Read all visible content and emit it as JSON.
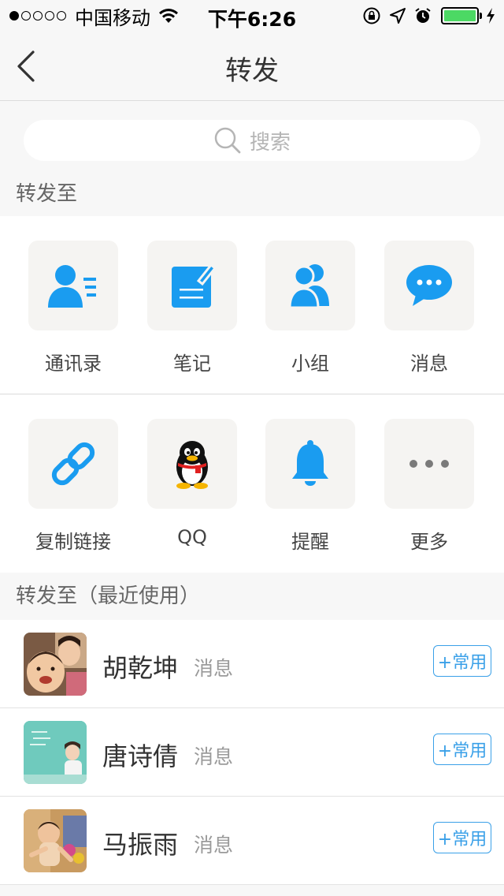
{
  "status_bar": {
    "signal_dots_filled": 1,
    "signal_dots_total": 5,
    "carrier": "中国移动",
    "time": "下午6:26",
    "battery_level": 1.0,
    "battery_color": "#4cd964",
    "icons": [
      "wifi-icon",
      "rotation-lock-icon",
      "location-arrow-icon",
      "alarm-icon",
      "charging-bolt-icon"
    ]
  },
  "nav": {
    "title": "转发",
    "back_icon": "chevron-left-icon"
  },
  "search": {
    "placeholder": "搜索"
  },
  "share_section": {
    "label": "转发至",
    "items": [
      {
        "label": "通讯录",
        "icon": "contacts-icon"
      },
      {
        "label": "笔记",
        "icon": "note-edit-icon"
      },
      {
        "label": "小组",
        "icon": "group-icon"
      },
      {
        "label": "消息",
        "icon": "chat-bubble-icon"
      },
      {
        "label": "复制链接",
        "icon": "link-icon"
      },
      {
        "label": "QQ",
        "icon": "qq-penguin-icon"
      },
      {
        "label": "提醒",
        "icon": "bell-icon"
      },
      {
        "label": "更多",
        "icon": "more-dots-icon"
      }
    ]
  },
  "recent_section": {
    "label": "转发至（最近使用）",
    "contacts": [
      {
        "name": "胡乾坤",
        "type": "消息",
        "action": "+常用"
      },
      {
        "name": "唐诗倩",
        "type": "消息",
        "action": "+常用"
      },
      {
        "name": "马振雨",
        "type": "消息",
        "action": "+常用"
      }
    ]
  },
  "colors": {
    "accent": "#1a9cf0",
    "background": "#f7f7f7",
    "tile": "#f5f4f2",
    "button_border": "#3aa0e8"
  }
}
